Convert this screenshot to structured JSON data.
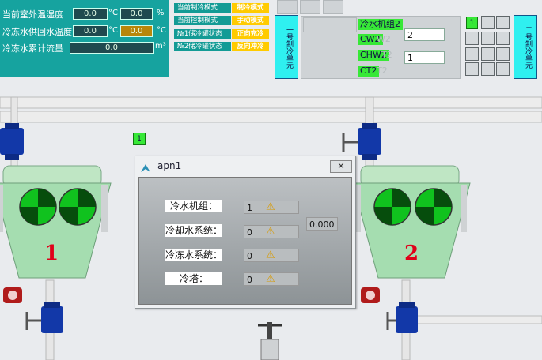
{
  "top_panel": {
    "outdoor_temp_label": "当前室外温湿度",
    "outdoor_temp_value": "0.0",
    "outdoor_temp_unit": "°C",
    "outdoor_hum_value": "0.0",
    "outdoor_hum_unit": "%",
    "chw_temp_label": "冷冻水供回水温度",
    "chw_supply_value": "0.0",
    "chw_supply_unit": "°C",
    "chw_return_value": "0.0",
    "chw_return_unit": "°C",
    "chw_flow_label": "冷冻水累计流量",
    "chw_flow_value": "0.0",
    "chw_flow_unit": "m³"
  },
  "modes": [
    {
      "label": "当前制冷模式",
      "value": "制冷模式"
    },
    {
      "label": "当前控制模式",
      "value": "手动模式"
    },
    {
      "label": "№1储冷罐状态",
      "value": "正向充冷"
    },
    {
      "label": "№2储冷罐状态",
      "value": "反向冲冷"
    }
  ],
  "vbar_left": "一号制冷单元",
  "vbar_right": "二号制冷单元",
  "unit_status": {
    "chiller_tag": "冷水机组2",
    "cw_tag": "CW2",
    "cw_ghost": "W2",
    "cw_value": "2",
    "chw_tag": "CHW2",
    "chw_ghost": "T2",
    "chw_value": "1",
    "ct_tag": "CT2",
    "ct_ghost": "T2"
  },
  "grid_badge": "1",
  "float_badge": "1",
  "dialog": {
    "title": "apn1",
    "rows": [
      {
        "label": "冷水机组：",
        "value": "1"
      },
      {
        "label": "冷却水系统：",
        "value": "0"
      },
      {
        "label": "冷冻水系统：",
        "value": "0"
      },
      {
        "label": "冷塔：",
        "value": "0"
      }
    ],
    "side_value": "0.000"
  },
  "units": {
    "left": "1",
    "right": "2"
  },
  "colors": {
    "panel": "#16a39f",
    "mode_value": "#ffcb00",
    "status_green": "#37e837",
    "unit_number": "#e0001a",
    "valve_blue": "#1238a8"
  }
}
